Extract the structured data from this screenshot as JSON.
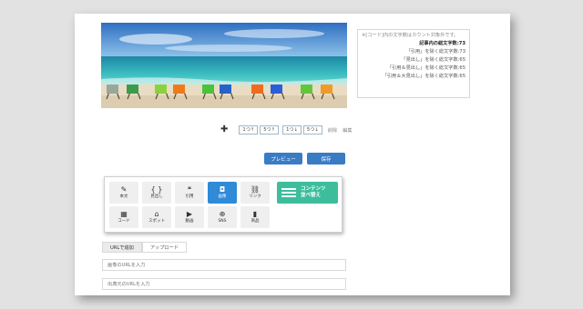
{
  "stats": {
    "note": "※[コード]内の文字数はカウント対象外です。",
    "total": "記事内の総文字数:73",
    "excl_quote": "「引用」を除く総文字数:73",
    "excl_heading": "「見出し」を除く総文字数:65",
    "excl_quote_heading": "「引用＆見出し」を除く総文字数:65",
    "excl_quote_large_heading": "「引用＆大見出し」を除く総文字数:65"
  },
  "move": {
    "plus_icon": "plus-icon",
    "up1": "1つ↑",
    "up5": "5つ↑",
    "down1": "1つ↓",
    "down5": "5つ↓",
    "delete": "削除",
    "edit": "編集"
  },
  "actions": {
    "preview": "プレビュー",
    "save": "保存"
  },
  "tools": [
    {
      "label": "本文",
      "icon": "✎",
      "icon_name": "pencil-icon"
    },
    {
      "label": "見出し",
      "icon": "{ }",
      "icon_name": "braces-icon"
    },
    {
      "label": "引用",
      "icon": "❝",
      "icon_name": "quote-icon"
    },
    {
      "label": "画像",
      "icon": "◘",
      "icon_name": "camera-icon"
    },
    {
      "label": "リンク",
      "icon": "⛓",
      "icon_name": "link-icon"
    },
    {
      "label": "コード",
      "icon": "▦",
      "icon_name": "code-icon"
    },
    {
      "label": "スポット",
      "icon": "⌂",
      "icon_name": "spot-icon"
    },
    {
      "label": "動画",
      "icon": "▶",
      "icon_name": "video-icon"
    },
    {
      "label": "SNS",
      "icon": "⊕",
      "icon_name": "sns-icon"
    },
    {
      "label": "商品",
      "icon": "▮",
      "icon_name": "product-icon"
    }
  ],
  "sort": {
    "line1": "コンテンツ",
    "line2": "並べ替え"
  },
  "tabs": {
    "url": "URLで追加",
    "upload": "アップロード"
  },
  "fields": {
    "image_url_placeholder": "画像のURLを入力",
    "source_url_placeholder": "出典元のURLを入力"
  },
  "colors": {
    "accent": "#3a7cc4",
    "image_active": "#2f8ad8",
    "sort_green": "#3dbd9c"
  }
}
